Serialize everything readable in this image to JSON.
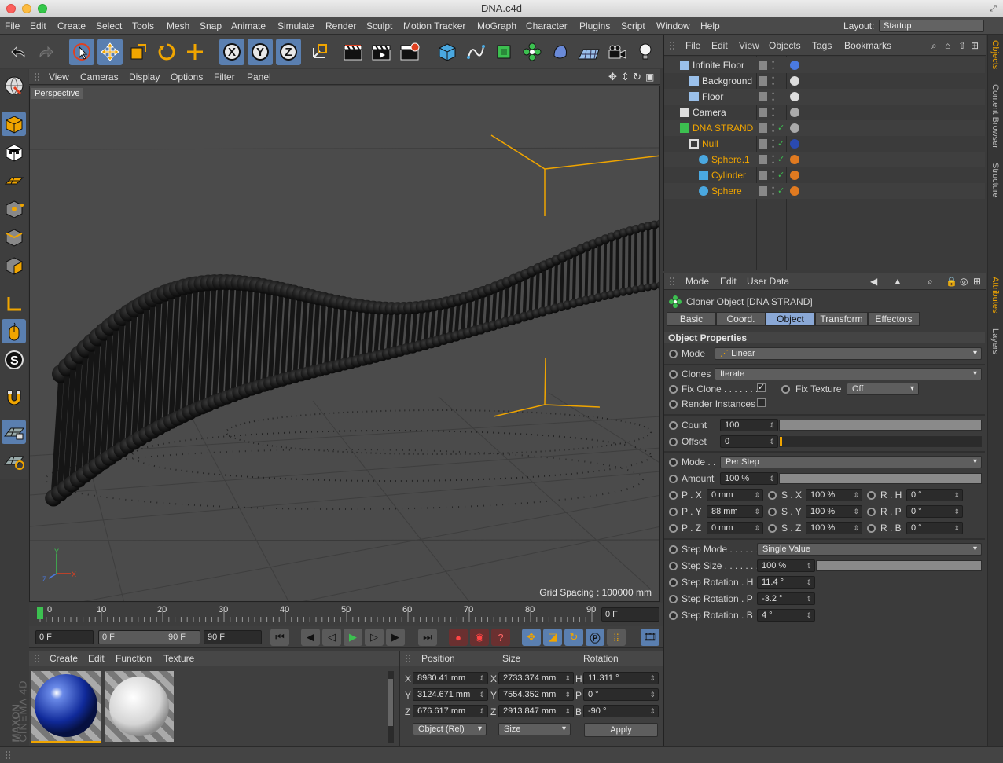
{
  "window": {
    "title": "DNA.c4d"
  },
  "menubar": {
    "items": [
      "File",
      "Edit",
      "Create",
      "Select",
      "Tools",
      "Mesh",
      "Snap",
      "Animate",
      "Simulate",
      "Render",
      "Sculpt",
      "Motion Tracker",
      "MoGraph",
      "Character",
      "Plugins",
      "Script",
      "Window",
      "Help"
    ],
    "layout_label": "Layout:",
    "layout_value": "Startup"
  },
  "viewport": {
    "menu": [
      "View",
      "Cameras",
      "Display",
      "Options",
      "Filter",
      "Panel"
    ],
    "label": "Perspective",
    "grid_spacing": "Grid Spacing : 100000 mm"
  },
  "timeline": {
    "ticks": [
      "0",
      "10",
      "20",
      "30",
      "40",
      "50",
      "60",
      "70",
      "80",
      "90"
    ],
    "current": "0 F"
  },
  "transport": {
    "start": "0 F",
    "range_start": "0 F",
    "range_end": "90 F",
    "end": "90 F"
  },
  "materials": {
    "menu": [
      "Create",
      "Edit",
      "Function",
      "Texture"
    ],
    "brand_top": "MAXON",
    "brand_bottom": "CINEMA 4D"
  },
  "coords": {
    "headers": [
      "Position",
      "Size",
      "Rotation"
    ],
    "rows": [
      {
        "axis": "X",
        "pos": "8980.41 mm",
        "saxis": "X",
        "size": "2733.374 mm",
        "raxis": "H",
        "rot": "11.311 °"
      },
      {
        "axis": "Y",
        "pos": "3124.671 mm",
        "saxis": "Y",
        "size": "7554.352 mm",
        "raxis": "P",
        "rot": "0 °"
      },
      {
        "axis": "Z",
        "pos": "676.617 mm",
        "saxis": "Z",
        "size": "2913.847 mm",
        "raxis": "B",
        "rot": "-90 °"
      }
    ],
    "mode": "Object (Rel)",
    "size_mode": "Size",
    "apply": "Apply"
  },
  "objects": {
    "menu": [
      "File",
      "Edit",
      "View",
      "Objects",
      "Tags",
      "Bookmarks"
    ],
    "items": [
      {
        "name": "Infinite Floor",
        "indent": 0,
        "hl": false
      },
      {
        "name": "Background",
        "indent": 1,
        "hl": false
      },
      {
        "name": "Floor",
        "indent": 1,
        "hl": false
      },
      {
        "name": "Camera",
        "indent": 0,
        "hl": false
      },
      {
        "name": "DNA STRAND",
        "indent": 0,
        "hl": true
      },
      {
        "name": "Null",
        "indent": 1,
        "hl": true
      },
      {
        "name": "Sphere.1",
        "indent": 2,
        "hl": true
      },
      {
        "name": "Cylinder",
        "indent": 2,
        "hl": true
      },
      {
        "name": "Sphere",
        "indent": 2,
        "hl": true
      }
    ]
  },
  "side_tabs": [
    "Objects",
    "Content Browser",
    "Structure",
    "Attributes",
    "Layers"
  ],
  "attributes": {
    "menu": [
      "Mode",
      "Edit",
      "User Data"
    ],
    "object_title": "Cloner Object [DNA STRAND]",
    "tabs": [
      "Basic",
      "Coord.",
      "Object",
      "Transform",
      "Effectors"
    ],
    "section": "Object Properties",
    "mode_label": "Mode",
    "mode_value": "Linear",
    "clones_label": "Clones",
    "clones_value": "Iterate",
    "fix_clone_label": "Fix Clone . . . . . . .",
    "fix_texture_label": "Fix Texture",
    "fix_texture_value": "Off",
    "render_instances_label": "Render Instances",
    "count_label": "Count",
    "count_value": "100",
    "offset_label": "Offset",
    "offset_value": "0",
    "mode2_label": "Mode . .",
    "mode2_value": "Per Step",
    "amount_label": "Amount",
    "amount_value": "100 %",
    "px_label": "P . X",
    "px": "0 mm",
    "py_label": "P . Y",
    "py": "88 mm",
    "pz_label": "P . Z",
    "pz": "0 mm",
    "sx_label": "S . X",
    "sx": "100 %",
    "sy_label": "S . Y",
    "sy": "100 %",
    "sz_label": "S . Z",
    "sz": "100 %",
    "rh_label": "R . H",
    "rh": "0 °",
    "rp_label": "R . P",
    "rp": "0 °",
    "rb_label": "R . B",
    "rb": "0 °",
    "step_mode_label": "Step Mode . . . . . . .",
    "step_mode_value": "Single Value",
    "step_size_label": "Step Size . . . . . . .",
    "step_size_value": "100 %",
    "step_rot_h_label": "Step Rotation . H",
    "step_rot_h": "11.4 °",
    "step_rot_p_label": "Step Rotation . P",
    "step_rot_p": "-3.2 °",
    "step_rot_b_label": "Step Rotation . B",
    "step_rot_b": "4 °"
  },
  "colors": {
    "accent": "#5a7fb0",
    "highlight": "#f0a500",
    "selected_tab": "#8aa8d6"
  }
}
